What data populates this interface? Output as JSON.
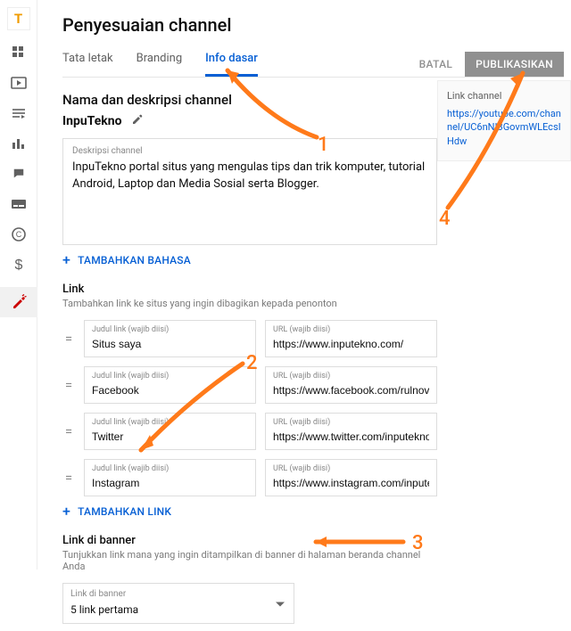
{
  "page": {
    "title": "Penyesuaian channel"
  },
  "tabs": {
    "layout": "Tata letak",
    "branding": "Branding",
    "basic_info": "Info dasar"
  },
  "actions": {
    "cancel": "BATAL",
    "publish": "PUBLIKASIKAN"
  },
  "channel": {
    "section_heading": "Nama dan deskripsi channel",
    "name": "InpuTekno",
    "desc_label": "Deskripsi channel",
    "description": "InpuTekno portal situs yang mengulas tips dan trik komputer, tutorial Android, Laptop dan Media Sosial serta Blogger.",
    "add_language": "TAMBAHKAN BAHASA"
  },
  "link_section": {
    "heading": "Link",
    "sub": "Tambahkan link ke situs yang ingin dibagikan kepada penonton",
    "title_label": "Judul link (wajib diisi)",
    "url_label": "URL (wajib diisi)",
    "add_link": "TAMBAHKAN LINK",
    "rows": [
      {
        "title": "Situs saya",
        "url": "https://www.inputekno.com/"
      },
      {
        "title": "Facebook",
        "url": "https://www.facebook.com/rulnovekom"
      },
      {
        "title": "Twitter",
        "url": "https://www.twitter.com/inputekno"
      },
      {
        "title": "Instagram",
        "url": "https://www.instagram.com/inputekno"
      }
    ]
  },
  "banner": {
    "heading": "Link di banner",
    "sub": "Tunjukkan link mana yang ingin ditampilkan di banner di halaman beranda channel Anda",
    "select_label": "Link di banner",
    "selected": "5 link pertama"
  },
  "channel_link": {
    "label": "Link channel",
    "url": "https://youtube.com/channel/UC6nNI3GovmWLEcsIHdw"
  },
  "rail_badge": "T",
  "annotations": {
    "n1": "1",
    "n2": "2",
    "n3": "3",
    "n4": "4"
  }
}
